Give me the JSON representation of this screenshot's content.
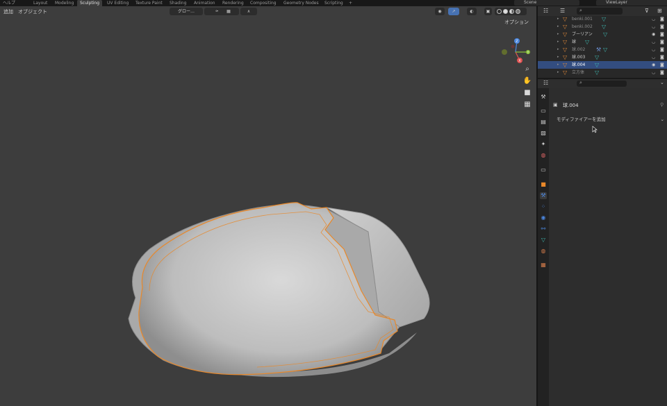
{
  "topbar": {
    "help_menu": "ヘルプ",
    "workspaces": [
      {
        "label": "Layout"
      },
      {
        "label": "Modeling"
      },
      {
        "label": "Sculpting"
      },
      {
        "label": "UV Editing"
      },
      {
        "label": "Texture Paint"
      },
      {
        "label": "Shading"
      },
      {
        "label": "Animation"
      },
      {
        "label": "Rendering"
      },
      {
        "label": "Compositing"
      },
      {
        "label": "Geometry Nodes"
      },
      {
        "label": "Scripting"
      },
      {
        "label": "+"
      }
    ],
    "active_workspace": "Sculpting",
    "scene": "Scene",
    "view_layer": "ViewLayer"
  },
  "viewport": {
    "menu_add": "追加",
    "menu_object": "オブジェクト",
    "transform_orientation": "グロー…",
    "options_label": "オプション",
    "gizmo_axes": [
      "X",
      "Y",
      "Z"
    ],
    "colors": {
      "background": "#3d3d3d",
      "selection_outline": "#e8882a",
      "gizmo_x": "#e05353",
      "gizmo_y": "#8ac23a",
      "gizmo_z": "#4b86dd"
    }
  },
  "outliner": {
    "rows": [
      {
        "name": "benki.001",
        "dim": true,
        "selected": false
      },
      {
        "name": "benki.002",
        "dim": true,
        "selected": false
      },
      {
        "name": "ブーリアン",
        "dim": false,
        "selected": false
      },
      {
        "name": "球",
        "dim": false,
        "selected": false
      },
      {
        "name": "球.002",
        "dim": true,
        "selected": false
      },
      {
        "name": "球.003",
        "dim": false,
        "selected": false
      },
      {
        "name": "球.004",
        "dim": false,
        "selected": true
      },
      {
        "name": "立方体",
        "dim": true,
        "selected": false
      }
    ],
    "colors": {
      "selected_row": "#334d80",
      "object_icon": "#e08a3a",
      "mesh_icon": "#3fb7b0"
    }
  },
  "properties": {
    "object_name": "球.004",
    "add_modifier_label": "モディファイアーを追加",
    "tabs": [
      "tool",
      "render",
      "output",
      "view-layer",
      "scene",
      "world",
      "collection",
      "object",
      "modifiers",
      "particles",
      "physics",
      "constraints",
      "data",
      "material",
      "texture"
    ],
    "active_tab": "modifiers"
  }
}
